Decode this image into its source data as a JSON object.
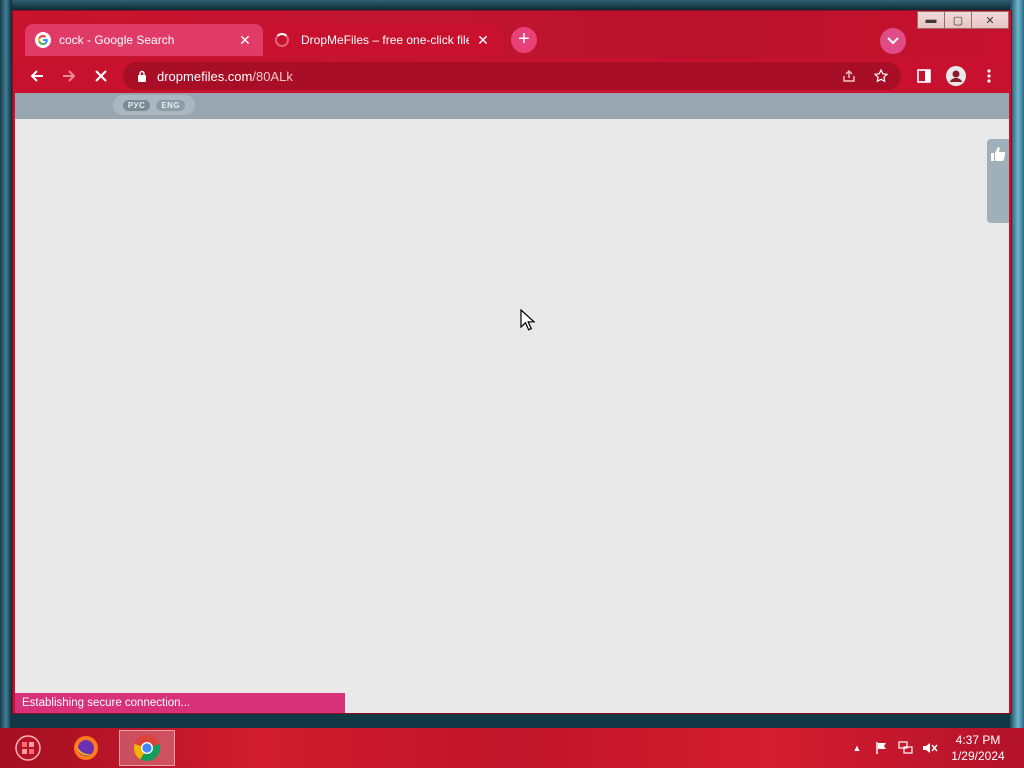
{
  "browser": {
    "tabs": [
      {
        "title": "cock - Google Search",
        "favicon": "google-icon",
        "close": "✕"
      },
      {
        "title": "DropMeFiles – free one-click file",
        "favicon": "loading-spinner",
        "close": "✕",
        "active": true
      }
    ],
    "new_tab": "+",
    "window_controls": {
      "minimize": "▬",
      "maximize": "▢",
      "close": "✕"
    },
    "address": {
      "host": "dropmefiles.com",
      "path": "/80ALk"
    },
    "accent": "#c8112e"
  },
  "page": {
    "languages": [
      "РУС",
      "ENG"
    ],
    "status_text": "Establishing secure connection..."
  },
  "taskbar": {
    "time": "4:37 PM",
    "date": "1/29/2024",
    "tray_up": "▲"
  }
}
